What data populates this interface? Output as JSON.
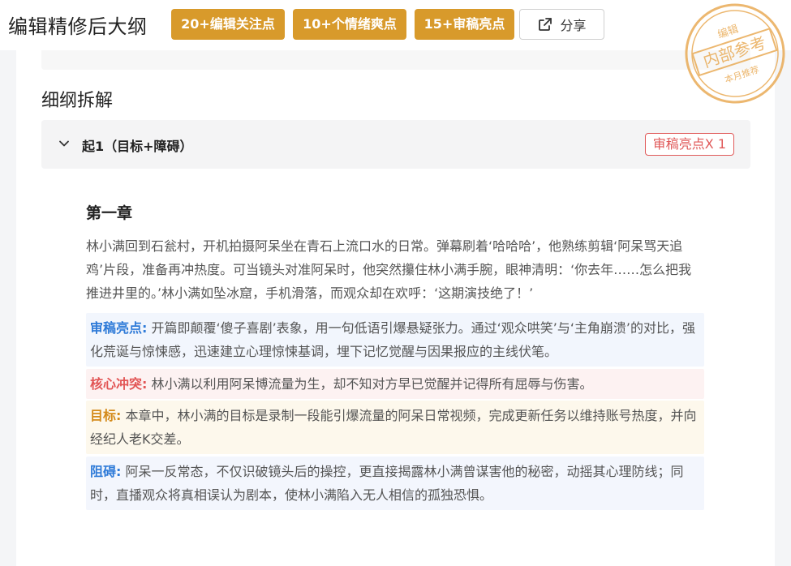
{
  "header": {
    "title": "编辑精修后大纲",
    "badges": [
      "20+编辑关注点",
      "10+个情绪爽点",
      "15+审稿亮点"
    ],
    "share_label": "分享"
  },
  "stamp": {
    "top": "编辑",
    "middle": "内部参考",
    "bottom": "本月推荐",
    "color": "#e8a64c"
  },
  "section": {
    "title": "细纲拆解"
  },
  "accordion": {
    "title": "起1（目标+障碍）",
    "tag": "审稿亮点X 1",
    "expanded": true
  },
  "chapter": {
    "title": "第一章",
    "text": "林小满回到石瓮村，开机拍摄阿呆坐在青石上流口水的日常。弹幕刷着‘哈哈哈’，他熟练剪辑‘阿呆骂天追鸡’片段，准备再冲热度。可当镜头对准阿呆时，他突然攥住林小满手腕，眼神清明：‘你去年……怎么把我推进井里的。’林小满如坠冰窟，手机滑落，而观众却在欢呼：‘这期演技绝了！’"
  },
  "notes": {
    "review": {
      "label": "审稿亮点:",
      "text": "开篇即颠覆‘傻子喜剧’表象，用一句低语引爆悬疑张力。通过‘观众哄笑’与‘主角崩溃’的对比，强化荒诞与惊悚感，迅速建立心理惊悚基调，埋下记忆觉醒与因果报应的主线伏笔。"
    },
    "conflict": {
      "label": "核心冲突:",
      "text": "林小满以利用阿呆博流量为生，却不知对方早已觉醒并记得所有屈辱与伤害。"
    },
    "goal": {
      "label": "目标:",
      "text": "本章中，林小满的目标是录制一段能引爆流量的阿呆日常视频，完成更新任务以维持账号热度，并向经纪人老K交差。"
    },
    "obstacle": {
      "label": "阻碍:",
      "text": "阿呆一反常态，不仅识破镜头后的操控，更直接揭露林小满曾谋害他的秘密，动摇其心理防线；同时，直播观众将真相误认为剧本，使林小满陷入无人相信的孤独恐惧。"
    }
  },
  "colors": {
    "badge": "#d89a2b",
    "review": "#2f7bd8",
    "conflict": "#e25555",
    "goal": "#d48a1a"
  }
}
